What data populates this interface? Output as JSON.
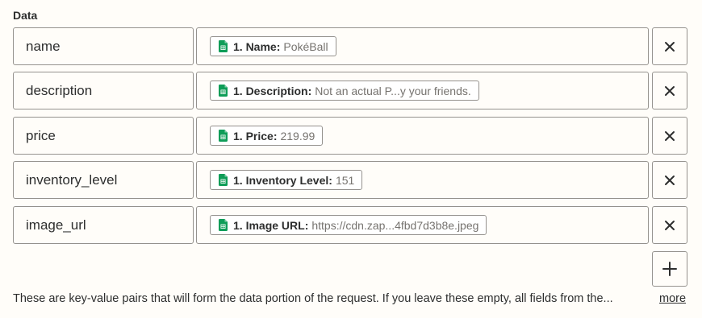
{
  "section": {
    "label": "Data"
  },
  "rows": [
    {
      "key": "name",
      "pill_label": "1. Name:",
      "pill_value": "PokéBall"
    },
    {
      "key": "description",
      "pill_label": "1. Description:",
      "pill_value": "Not an actual P...y your friends."
    },
    {
      "key": "price",
      "pill_label": "1. Price:",
      "pill_value": "219.99"
    },
    {
      "key": "inventory_level",
      "pill_label": "1. Inventory Level:",
      "pill_value": "151"
    },
    {
      "key": "image_url",
      "pill_label": "1. Image URL:",
      "pill_value": "https://cdn.zap...4fbd7d3b8e.jpeg"
    }
  ],
  "icons": {
    "pill": "google-sheets-icon",
    "remove": "close-icon",
    "add": "plus-icon"
  },
  "colors": {
    "background": "#fffdf9",
    "border": "#95928e",
    "sheets_green": "#0f9d58",
    "muted_text": "#76736f"
  },
  "help": {
    "text": "These are key-value pairs that will form the data portion of the request. If you leave these empty, all fields from the...",
    "more_label": "more"
  }
}
